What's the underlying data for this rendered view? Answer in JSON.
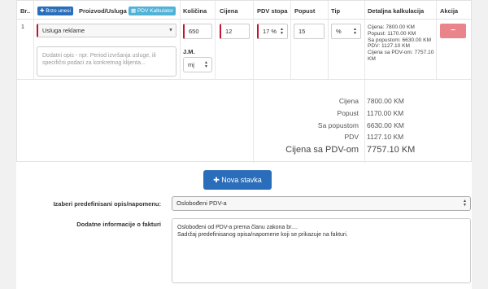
{
  "table": {
    "headers": {
      "rb": "Br..",
      "brzo_unesi": "Brzo unesi",
      "proizvod": "Proizvod/Usluga",
      "pdv_kalkulator": "PDV Kalkulator",
      "kolicina": "Količina",
      "cijena": "Cijena",
      "pdv_stopa": "PDV stopa",
      "popust": "Popust",
      "tip": "Tip",
      "detaljna": "Detaljna kalkulacija",
      "akcija": "Akcija"
    },
    "row": {
      "number": "1",
      "product": "Usluga reklame",
      "description_placeholder": "Dodatni opis - npr. Period izvršanja usluge, ili specifični podaci za konkretnog klijenta...",
      "quantity": "650",
      "unit_label": "J.M.",
      "unit": "mj",
      "price": "12",
      "vat_rate": "17 %",
      "discount": "15",
      "type": "%",
      "detail": [
        "Cijena: 7800.00 KM",
        "Popust: 1170.00 KM",
        "Sa popustom: 6630.00 KM",
        "PDV: 1127.10 KM",
        "Cijena sa PDV-om: 7757.10 KM"
      ],
      "delete_symbol": "−"
    }
  },
  "summary": [
    {
      "label": "Cijena",
      "value": "7800.00 KM"
    },
    {
      "label": "Popust",
      "value": "1170.00 KM"
    },
    {
      "label": "Sa popustom",
      "value": "6630.00 KM"
    },
    {
      "label": "PDV",
      "value": "1127.10 KM"
    },
    {
      "label": "Cijena sa PDV-om",
      "value": "7757.10 KM"
    }
  ],
  "nova_stavka": "Nova stavka",
  "form": {
    "predefined_label": "Izaberi predefinisani opis/napomenu:",
    "predefined_value": "Oslobođeni PDV-a",
    "extra_label": "Dodatne informacije o fakturi",
    "extra_text_line1": "Oslobođeni od PDV-a prema članu zakona br....",
    "extra_text_line2": "Sadržaj predefinisanog opisa/napomene koji se prikazuje na fakturi."
  },
  "icons": {
    "plus": "plus-icon",
    "calculator": "calculator-icon",
    "caret": "caret-down-icon",
    "updown": "sort-updown-icon",
    "select_arrows": "select-arrows-icon"
  },
  "colors": {
    "primary": "#2a6ebb",
    "cyan": "#4fb2d6",
    "danger": "#e9858a",
    "required": "#c0152f"
  }
}
